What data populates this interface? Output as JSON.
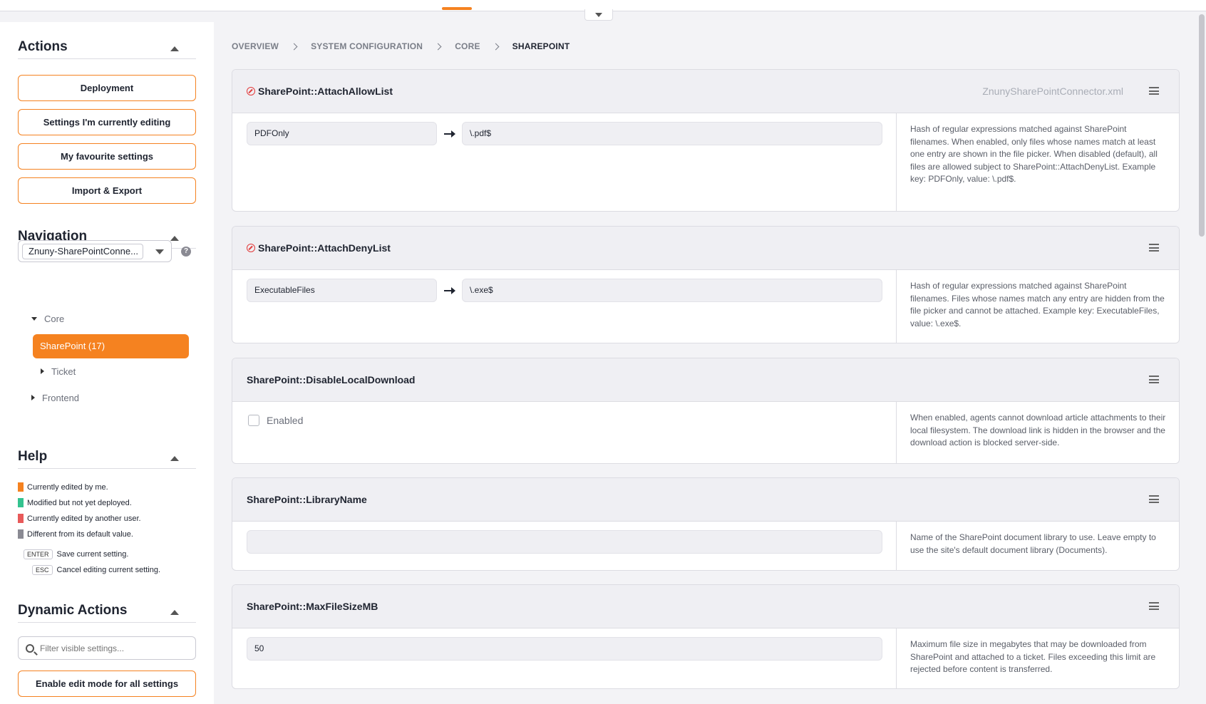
{
  "actions": {
    "title": "Actions",
    "buttons": [
      "Deployment",
      "Settings I'm currently editing",
      "My favourite settings",
      "Import & Export"
    ]
  },
  "navigation": {
    "title": "Navigation",
    "selected": "Znuny-SharePointConne...",
    "tree": {
      "core": "Core",
      "sharepoint": "SharePoint (17)",
      "ticket": "Ticket",
      "frontend": "Frontend"
    }
  },
  "help": {
    "title": "Help",
    "legend": [
      {
        "color": "#f58220",
        "label": "Currently edited by me."
      },
      {
        "color": "#34c38f",
        "label": "Modified but not yet deployed."
      },
      {
        "color": "#e85a5a",
        "label": "Currently edited by another user."
      },
      {
        "color": "#8a8a93",
        "label": "Different from its default value."
      }
    ],
    "shortcuts": [
      {
        "key": "ENTER",
        "label": "Save current setting."
      },
      {
        "key": "ESC",
        "label": "Cancel editing current setting."
      }
    ]
  },
  "dynamic_actions": {
    "title": "Dynamic Actions",
    "filter_placeholder": "Filter visible settings...",
    "edit_all_label": "Enable edit mode for all settings"
  },
  "breadcrumb": [
    "OVERVIEW",
    "SYSTEM CONFIGURATION",
    "CORE",
    "SHAREPOINT"
  ],
  "settings": [
    {
      "name": "SharePoint::AttachAllowList",
      "file": "ZnunySharePointConnector.xml",
      "key": "PDFOnly",
      "value": "\\.pdf$",
      "description": "Hash of regular expressions matched against SharePoint filenames. When enabled, only files whose names match at least one entry are shown in the file picker. When disabled (default), all files are allowed subject to SharePoint::AttachDenyList. Example key: PDFOnly, value: \\.pdf$."
    },
    {
      "name": "SharePoint::AttachDenyList",
      "key": "ExecutableFiles",
      "value": "\\.exe$",
      "description": "Hash of regular expressions matched against SharePoint filenames. Files whose names match any entry are hidden from the file picker and cannot be attached. Example key: ExecutableFiles, value: \\.exe$."
    },
    {
      "name": "SharePoint::DisableLocalDownload",
      "checkbox_label": "Enabled",
      "description": "When enabled, agents cannot download article attachments to their local filesystem. The download link is hidden in the browser and the download action is blocked server-side."
    },
    {
      "name": "SharePoint::LibraryName",
      "value": "",
      "description": "Name of the SharePoint document library to use. Leave empty to use the site's default document library (Documents)."
    },
    {
      "name": "SharePoint::MaxFileSizeMB",
      "value": "50",
      "description": "Maximum file size in megabytes that may be downloaded from SharePoint and attached to a ticket. Files exceeding this limit are rejected before content is transferred."
    }
  ]
}
